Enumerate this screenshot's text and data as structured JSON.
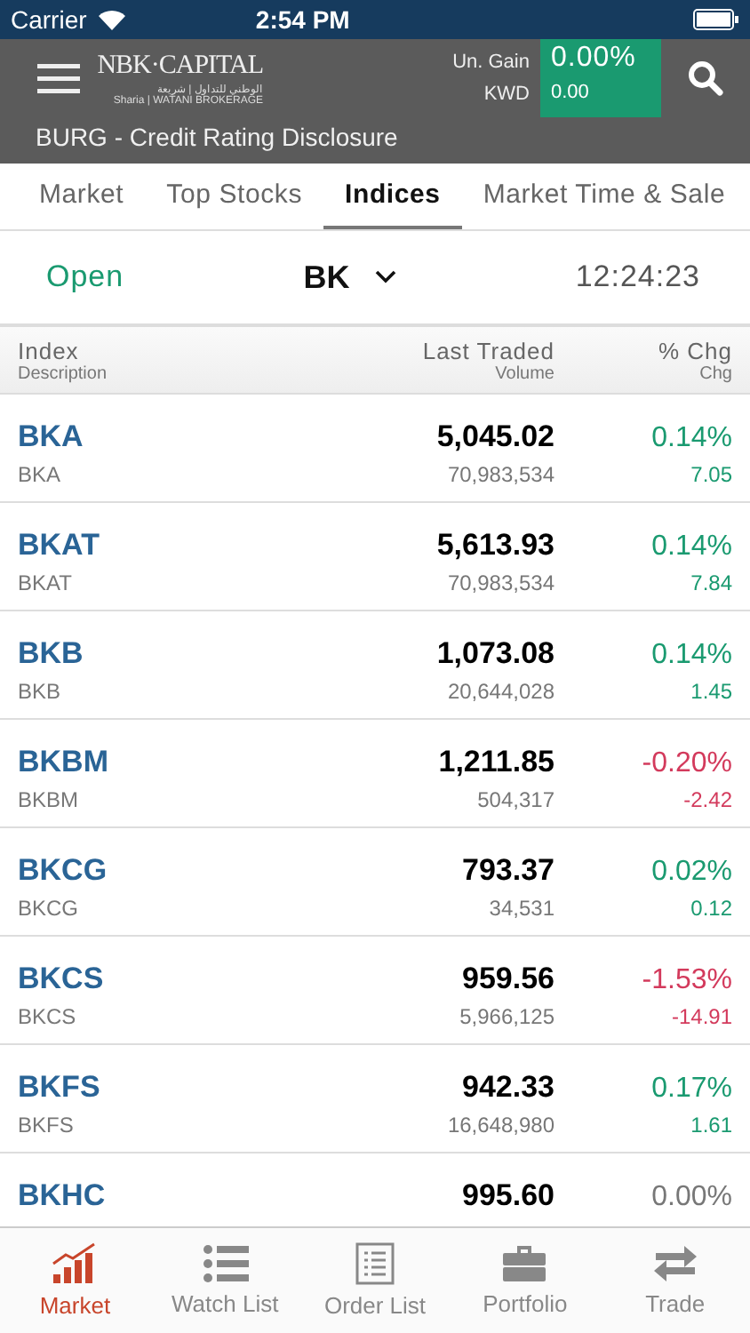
{
  "status_bar": {
    "carrier": "Carrier",
    "time": "2:54 PM"
  },
  "header": {
    "logo": {
      "name": "NBK·CAPITAL",
      "arabic": "الوطني للتداول | شريعة",
      "sub": "Sharia | WATANI BROKERAGE"
    },
    "gain": {
      "label": "Un. Gain",
      "value": "0.00%",
      "currency": "KWD",
      "amount": "0.00"
    },
    "ticker": "BURG - Credit Rating Disclosure"
  },
  "tabs": [
    {
      "label": "Market",
      "selected": false
    },
    {
      "label": "Top Stocks",
      "selected": false
    },
    {
      "label": "Indices",
      "selected": true
    },
    {
      "label": "Market Time & Sale",
      "selected": false
    }
  ],
  "market_bar": {
    "status": "Open",
    "exchange": "BK",
    "time": "12:24:23"
  },
  "table": {
    "columns": [
      {
        "top": "Index",
        "bottom": "Description"
      },
      {
        "top": "Last Traded",
        "bottom": "Volume"
      },
      {
        "top": "% Chg",
        "bottom": "Chg"
      }
    ],
    "rows": [
      {
        "index": "BKA",
        "last": "5,045.02",
        "pct": "0.14%",
        "color": "#1a9a70",
        "description": "BKA",
        "volume": "70,983,534",
        "chg": "7.05"
      },
      {
        "index": "BKAT",
        "last": "5,613.93",
        "pct": "0.14%",
        "color": "#1a9a70",
        "description": "BKAT",
        "volume": "70,983,534",
        "chg": "7.84"
      },
      {
        "index": "BKB",
        "last": "1,073.08",
        "pct": "0.14%",
        "color": "#1a9a70",
        "description": "BKB",
        "volume": "20,644,028",
        "chg": "1.45"
      },
      {
        "index": "BKBM",
        "last": "1,211.85",
        "pct": "-0.20%",
        "color": "#d33a5c",
        "description": "BKBM",
        "volume": "504,317",
        "chg": "-2.42"
      },
      {
        "index": "BKCG",
        "last": "793.37",
        "pct": "0.02%",
        "color": "#1a9a70",
        "description": "BKCG",
        "volume": "34,531",
        "chg": "0.12"
      },
      {
        "index": "BKCS",
        "last": "959.56",
        "pct": "-1.53%",
        "color": "#d33a5c",
        "description": "BKCS",
        "volume": "5,966,125",
        "chg": "-14.91"
      },
      {
        "index": "BKFS",
        "last": "942.33",
        "pct": "0.17%",
        "color": "#1a9a70",
        "description": "BKFS",
        "volume": "16,648,980",
        "chg": "1.61"
      },
      {
        "index": "BKHC",
        "last": "995.60",
        "pct": "0.00%",
        "color": "#777777"
      }
    ]
  },
  "bottom_nav": [
    {
      "label": "Market",
      "kind": "chart",
      "selected": true
    },
    {
      "label": "Watch List",
      "kind": "list",
      "selected": false
    },
    {
      "label": "Order List",
      "kind": "document",
      "selected": false
    },
    {
      "label": "Portfolio",
      "kind": "briefcase",
      "selected": false
    },
    {
      "label": "Trade",
      "kind": "arrows",
      "selected": false
    }
  ]
}
